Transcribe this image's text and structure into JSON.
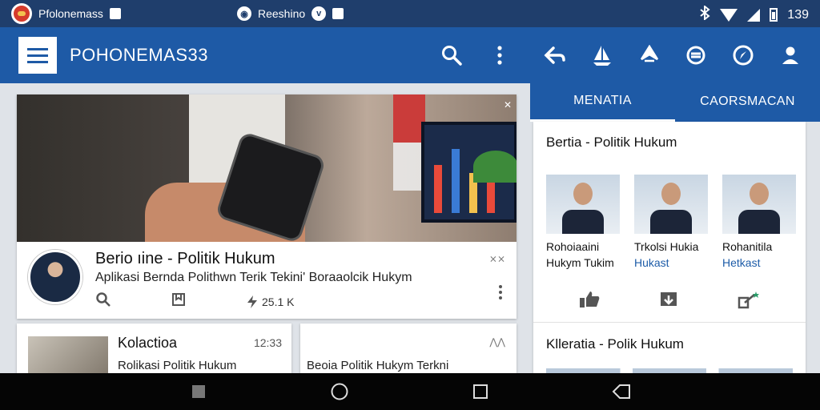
{
  "status_bar": {
    "app_name": "Pfolonemass",
    "center_label": "Reeshino",
    "time": "139",
    "icons": [
      "app-logo-icon",
      "stop-icon",
      "vpn-icon",
      "vibrate-icon",
      "cast-icon",
      "bluetooth-icon",
      "wifi-icon",
      "signal-icon",
      "battery-icon"
    ]
  },
  "app_bar": {
    "title": "POHONEMAS33",
    "icons": [
      "menu-icon",
      "search-icon",
      "more-vertical-icon"
    ]
  },
  "right_panel": {
    "icons": [
      "back-icon",
      "sailboat-icon",
      "network-icon",
      "refresh-icon",
      "compass-icon",
      "user-icon"
    ],
    "tabs": [
      "MENATIA",
      "CAORSMACAN"
    ]
  },
  "hero_card": {
    "title": "Berio ıine - Politik Hukum",
    "description": "Aplikasi Bernda Polithwn Terik Tekini' Boraaolcik Hukym",
    "count": "25.1 K",
    "close_label": "✕",
    "collapse_label": "⨯⨯"
  },
  "small_card_left": {
    "title": "Kolactioa",
    "time": "12:33",
    "description": "Rolikasi Politik Hukum"
  },
  "small_card_right": {
    "description": "Beoia Politik Hukym Terkni",
    "chevron_label": "⋀⋀"
  },
  "side_panel": {
    "heading": "Bertia - Politik Hukum",
    "thumbs": [
      {
        "line1": "Rohoiaaini",
        "line2": "Hukym Tukim",
        "accent": false
      },
      {
        "line1": "Trkolsi Hukia",
        "line2": "Hukast",
        "accent": true
      },
      {
        "line1": "Rohanitila",
        "line2": "Hetkast",
        "accent": true
      }
    ],
    "actions": [
      "thumbs-up-icon",
      "download-icon",
      "share-icon"
    ],
    "heading2": "Klleratia - Polik Hukum"
  },
  "nav_bar": {
    "buttons": [
      "square-icon",
      "home-circle-icon",
      "overview-icon",
      "back-nav-icon"
    ]
  },
  "colors": {
    "primary": "#1e5aa6",
    "status_bar": "#1f3e6c",
    "accent_text": "#1d5ca8",
    "background": "#dfe3e8",
    "nav_bar": "#050505"
  }
}
